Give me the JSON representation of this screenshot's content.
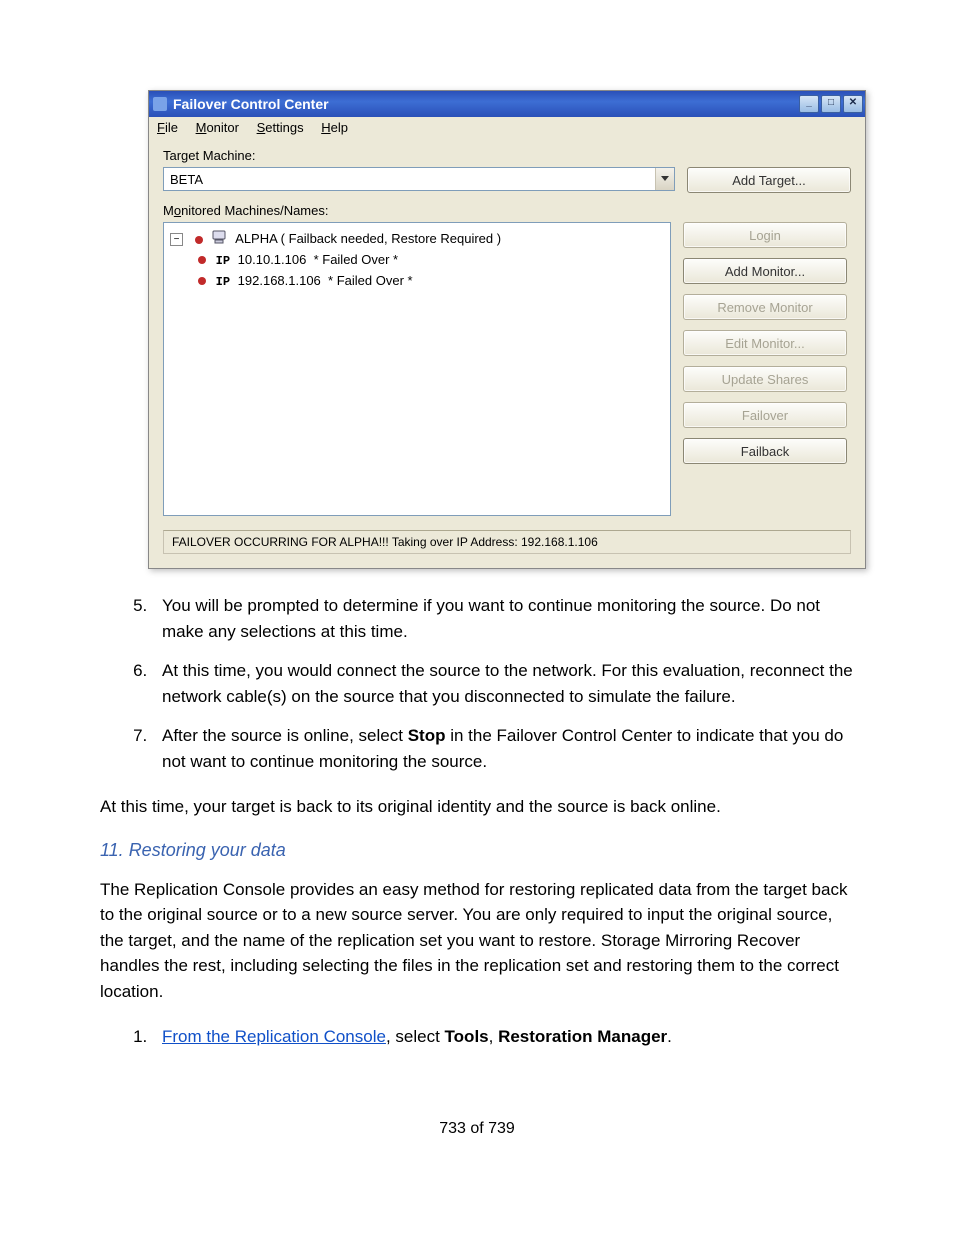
{
  "window": {
    "title": "Failover Control Center",
    "menu": {
      "file": "File",
      "monitor": "Monitor",
      "settings": "Settings",
      "help": "Help"
    },
    "target_label": "Target Machine:",
    "target_value": "BETA",
    "add_target": "Add Target...",
    "monitored_label": "Monitored Machines/Names:",
    "tree": {
      "root": "ALPHA ( Failback needed, Restore Required )",
      "ip1_label": "IP",
      "ip1_addr": "10.10.1.106",
      "ip1_status": "* Failed Over *",
      "ip2_label": "IP",
      "ip2_addr": "192.168.1.106",
      "ip2_status": "* Failed Over *"
    },
    "buttons": {
      "login": "Login",
      "add_monitor": "Add Monitor...",
      "remove_monitor": "Remove Monitor",
      "edit_monitor": "Edit Monitor...",
      "update_shares": "Update Shares",
      "failover": "Failover",
      "failback": "Failback"
    },
    "status": "FAILOVER OCCURRING FOR ALPHA!!!  Taking over IP Address: 192.168.1.106"
  },
  "doc": {
    "step5": "You will be prompted to determine if you want to continue monitoring the source. Do not make any selections at this time.",
    "step6": "At this time, you would connect the source to the network. For this evaluation, reconnect the network cable(s) on the source that you disconnected to simulate the failure.",
    "step7_pre": "After the source is online, select ",
    "step7_bold": "Stop",
    "step7_post": " in the Failover Control Center to indicate that you do not want to continue monitoring the source.",
    "after_list": "At this time, your target is back to its original identity and the source is back online.",
    "heading": "11. Restoring your data",
    "para2": "The Replication Console provides an easy method for restoring replicated data from the target back to the original source or to a new source server. You are only required to input the original source, the target, and the name of the replication set you want to restore. Storage Mirroring Recover handles the rest, including selecting the files in the replication set and restoring them to the correct location.",
    "step1_link": "From the Replication Console",
    "step1_mid": ", select ",
    "step1_b1": "Tools",
    "step1_sep": ", ",
    "step1_b2": "Restoration Manager",
    "step1_end": ".",
    "page_num": "733 of 739"
  }
}
